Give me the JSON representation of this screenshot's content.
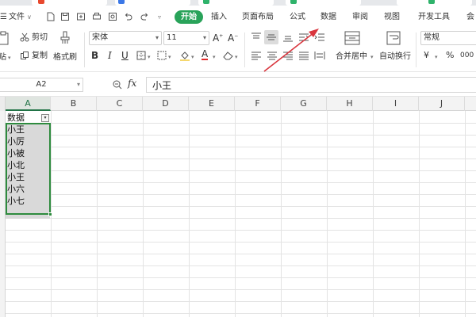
{
  "quick_access": {
    "file_label": "文件"
  },
  "menu": {
    "tabs": [
      {
        "label": "开始",
        "active": true
      },
      {
        "label": "插入"
      },
      {
        "label": "页面布局"
      },
      {
        "label": "公式"
      },
      {
        "label": "数据"
      },
      {
        "label": "审阅"
      },
      {
        "label": "视图"
      },
      {
        "label": "开发工具"
      },
      {
        "label": "会"
      }
    ]
  },
  "ribbon": {
    "clipboard": {
      "cut_label": "剪切",
      "paste_label": "贴",
      "copy_label": "复制",
      "format_painter_label": "格式刷"
    },
    "font": {
      "font_name": "宋体",
      "font_size": "11"
    },
    "alignment": {
      "merge_center_label": "合并居中",
      "wrap_text_label": "自动换行"
    },
    "number": {
      "format_value": "常规",
      "currency_symbol": "¥",
      "percent_symbol": "%",
      "thousands_symbol": "000"
    }
  },
  "formula_bar": {
    "cell_ref": "A2",
    "fx_label": "fx",
    "value": "小王"
  },
  "sheet": {
    "columns": [
      "A",
      "B",
      "C",
      "D",
      "E",
      "F",
      "G",
      "H",
      "I",
      "J"
    ],
    "header_cell": "数据",
    "filter_glyph": "▾",
    "values": [
      "小王",
      "小厉",
      "小被",
      "小北",
      "小王",
      "小六",
      "小七"
    ]
  },
  "colors": {
    "accent_green": "#29a35a",
    "selection_green": "#2e8b3e",
    "annotation_arrow": "#d9363e"
  }
}
